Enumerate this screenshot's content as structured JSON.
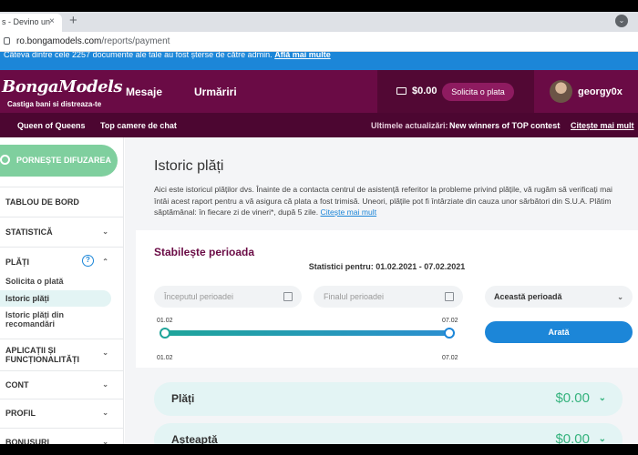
{
  "browser": {
    "tab_title": "s - Devino un",
    "tab_close": "×",
    "new_tab": "+",
    "dropdown_glyph": "⌄",
    "url_host": "ro.bongamodels.com",
    "url_path": "/reports/payment"
  },
  "notice": {
    "text": "Câteva dintre cele 2257 documente ale tale au fost șterse de către admin.",
    "link": "Află mai multe"
  },
  "header": {
    "logo": "BongaModels",
    "tagline": "Castiga bani si distreaza-te",
    "nav": [
      "Mesaje",
      "Urmăriri"
    ],
    "balance": "$0.00",
    "request_payout": "Solicita o plata",
    "username": "georgy0x"
  },
  "subnav": {
    "items": [
      "Queen of Queens",
      "Top camere de chat"
    ],
    "updates_label": "Ultimele actualizări:",
    "updates_text": "New winners of TOP contests!",
    "read_more": "Citește mai mult"
  },
  "sidebar": {
    "go_live": "PORNEȘTE DIFUZAREA",
    "dashboard": "TABLOU DE BORD",
    "statistics": "STATISTICĂ",
    "payments": "PLĂȚI",
    "payments_sub": [
      "Solicita o plată",
      "Istoric plăți",
      "Istoric plăți din recomandări"
    ],
    "apps": "APLICAȚII ȘI FUNCȚIONALITĂȚI",
    "account": "CONT",
    "profile": "PROFIL",
    "bonuses": "BONUSURI",
    "help_glyph": "?",
    "chevron_down": "⌄",
    "chevron_up": "⌃"
  },
  "main": {
    "title": "Istoric plăți",
    "intro": "Aici este istoricul plăților dvs. Înainte de a contacta centrul de asistență referitor la probleme privind plățile, vă rugăm să verificați mai întâi acest raport pentru a vă asigura că plata a fost trimisă. Uneori, plățile pot fi întârziate din cauza unor sărbători din S.U.A. Plătim săptămânal: în fiecare zi de vineri*, după 5 zile.",
    "intro_link": "Citește mai mult",
    "period": {
      "title": "Stabilește perioada",
      "stats_for": "Statistici pentru: 01.02.2021 - 07.02.2021",
      "start_placeholder": "Începutul perioadei",
      "end_placeholder": "Finalul perioadei",
      "select_value": "Această perioadă",
      "slider_start": "01.02",
      "slider_end": "07.02",
      "slider_fill": 1.0,
      "show_button": "Arată"
    },
    "accordions": [
      {
        "label": "Plăți",
        "amount": "$0.00"
      },
      {
        "label": "Așteaptă",
        "amount": "$0.00"
      }
    ]
  },
  "colors": {
    "brand": "#6a0b45",
    "accent": "#1c86d8",
    "success": "#36b37e"
  }
}
